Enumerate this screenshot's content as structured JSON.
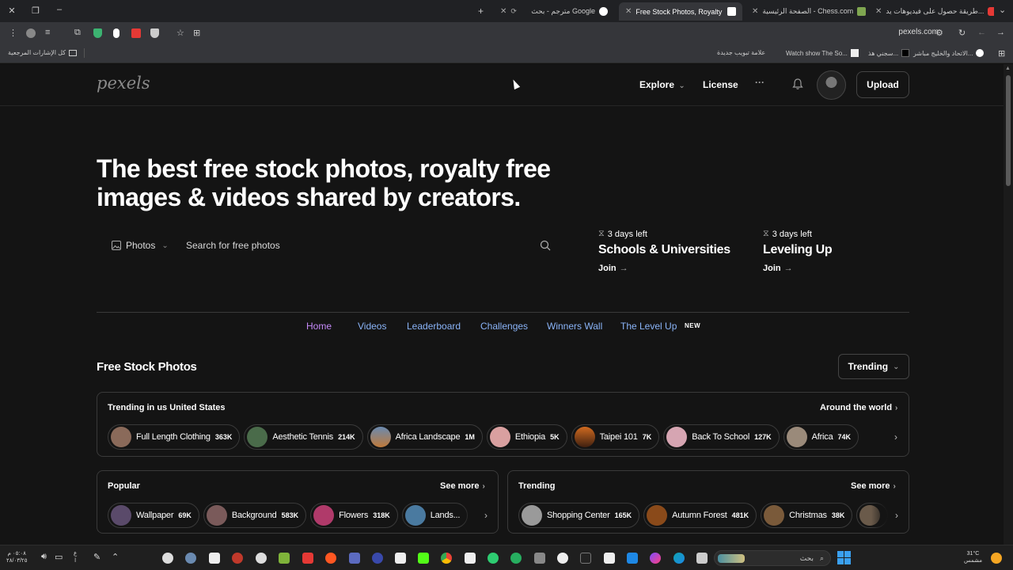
{
  "browser": {
    "tabs": [
      {
        "title": "طريقة حصول على فيديوهات يد...",
        "favicon_color": "#e53935"
      },
      {
        "title": "الصفحة الرئيسية - Chess.com",
        "favicon_color": "#7fa650"
      },
      {
        "title": "Free Stock Photos, Royalty Free...",
        "favicon_color": "#ffffff",
        "active": true
      },
      {
        "title": "مترجم - بحث Google",
        "favicon_color": "#ffffff"
      }
    ],
    "url": "pexels.com",
    "bookmarks": [
      {
        "label": "الاتحاد والخليج مباشر..."
      },
      {
        "label": "سجني هذ..."
      },
      {
        "label": "Watch show The So..."
      },
      {
        "label": "علامة تبويب جديدة"
      },
      {
        "label": "كل الإشارات المرجعية"
      }
    ]
  },
  "nav": {
    "logo": "pexels",
    "explore": "Explore",
    "license": "License",
    "more": "···",
    "upload": "Upload"
  },
  "hero": {
    "headline": "The best free stock photos, royalty free images & videos shared by creators."
  },
  "search": {
    "type_label": "Photos",
    "placeholder": "Search for free photos"
  },
  "challenges": [
    {
      "days": "3 days left",
      "title": "Schools & Universities",
      "join": "Join"
    },
    {
      "days": "3 days left",
      "title": "Leveling Up",
      "join": "Join"
    }
  ],
  "subnav": {
    "items": [
      "Home",
      "Videos",
      "Leaderboard",
      "Challenges",
      "Winners Wall",
      "The Level Up"
    ],
    "new_badge": "NEW"
  },
  "section": {
    "title": "Free Stock Photos",
    "sort": "Trending"
  },
  "trending_us": {
    "title": "Trending in us United States",
    "link": "Around the world",
    "chips": [
      {
        "label": "Full Length Clothing",
        "count": "363K",
        "color": "#8a6a5a"
      },
      {
        "label": "Aesthetic Tennis",
        "count": "214K",
        "color": "#4a6b4a"
      },
      {
        "label": "Africa Landscape",
        "count": "1M",
        "color": "#c07a3a"
      },
      {
        "label": "Ethiopia",
        "count": "5K",
        "color": "#d9a0a0"
      },
      {
        "label": "Taipei 101",
        "count": "7K",
        "color": "#b0521f"
      },
      {
        "label": "Back To School",
        "count": "127K",
        "color": "#d6a5b2"
      },
      {
        "label": "Africa",
        "count": "74K",
        "color": "#9a8a7a"
      }
    ]
  },
  "popular": {
    "title": "Popular",
    "link": "See more",
    "chips": [
      {
        "label": "Wallpaper",
        "count": "69K",
        "color": "#5a4a6a"
      },
      {
        "label": "Background",
        "count": "583K",
        "color": "#7a5a5a"
      },
      {
        "label": "Flowers",
        "count": "318K",
        "color": "#b03a6a"
      },
      {
        "label": "Lands...",
        "count": "",
        "color": "#4a7aa0"
      }
    ]
  },
  "trending": {
    "title": "Trending",
    "link": "See more",
    "chips": [
      {
        "label": "Shopping Center",
        "count": "165K",
        "color": "#9a9a9a"
      },
      {
        "label": "Autumn Forest",
        "count": "481K",
        "color": "#8a4a1a"
      },
      {
        "label": "Christmas",
        "count": "38K",
        "color": "#7a5a3a"
      }
    ]
  },
  "taskbar": {
    "search_placeholder": "بحث",
    "weather": "31°C",
    "weather_desc": "مشمس",
    "time": "٠٥:٠٨ م",
    "date": "٢٨/٠٣/٢٥"
  }
}
